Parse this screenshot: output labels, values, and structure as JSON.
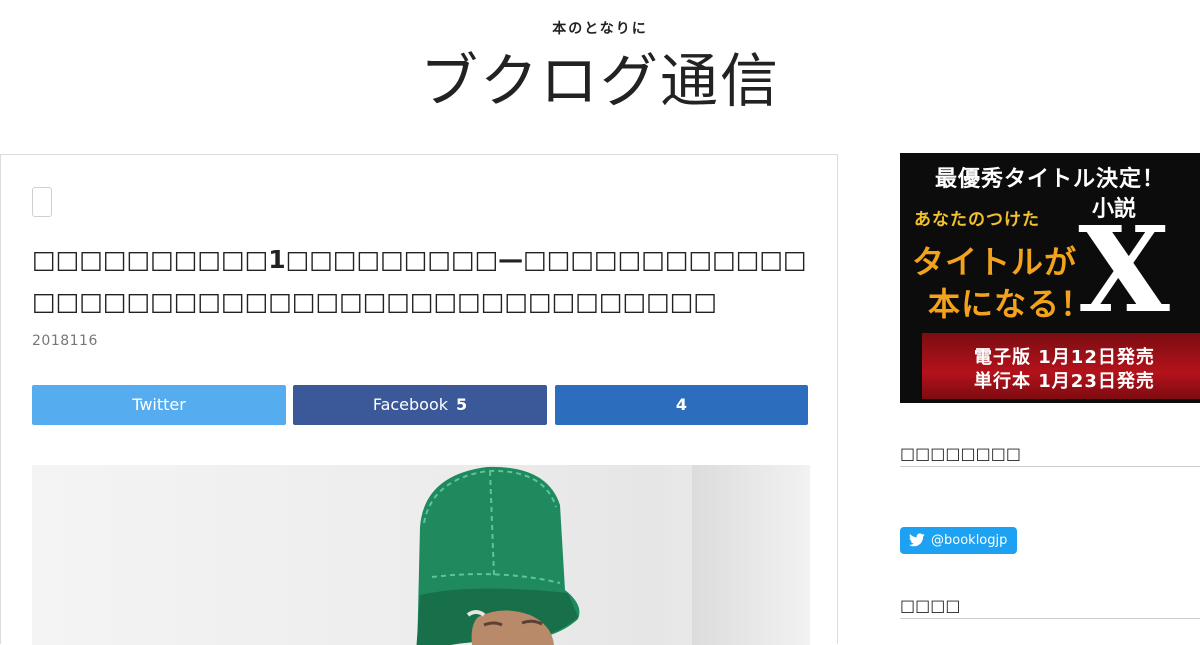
{
  "header": {
    "tagline": "本のとなりに",
    "logo_text": "ブクログ通信"
  },
  "article": {
    "title": "□□□□□□□□□□1□□□□□□□□□—□□□□□□□□□□□□□□□□□□□□□□□□□□□□□□□□□□□□□□□□□",
    "date": "2018116",
    "share": {
      "twitter_label": "Twitter",
      "facebook_label": "Facebook",
      "facebook_count": "5",
      "hatena_count": "4"
    }
  },
  "sidebar": {
    "banner": {
      "headline": "最優秀タイトル決定！",
      "small_text": "あなたのつけた",
      "big_line1": "タイトルが",
      "big_line2": "本になる！",
      "novel_label": "小説",
      "novel_title": "X",
      "release_line1": "電子版 1月12日発売",
      "release_line2": "単行本 1月23日発売",
      "colors": {
        "background": "#0c0c0c",
        "orange": "#f3a21c",
        "red": "#b5121b"
      }
    },
    "widget_title_1": "□□□□□□□□",
    "follow_button": "@booklogjp",
    "widget_title_2": "□□□□"
  },
  "colors": {
    "twitter": "#55acee",
    "facebook": "#3b5998",
    "hatena": "#2c6ebd",
    "follow": "#1da1f2"
  }
}
